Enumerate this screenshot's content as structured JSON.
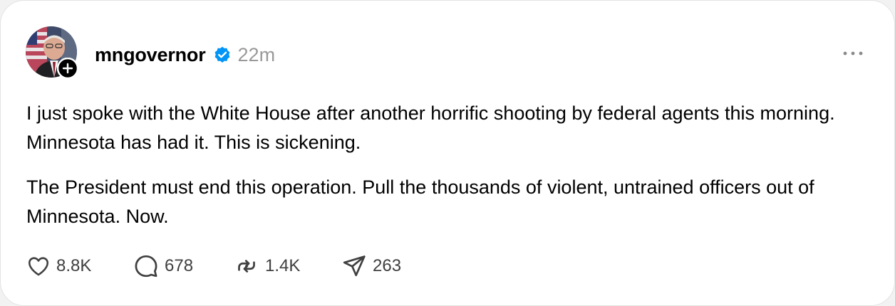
{
  "post": {
    "username": "mngovernor",
    "verified": true,
    "timestamp": "22m",
    "more_icon": "more-horizontal-icon",
    "paragraphs": [
      "I just spoke with the White House after another horrific shooting by federal agents this morning. Minnesota has had it. This is sickening.",
      "The President must end this operation. Pull the thousands of violent, untrained officers out of Minnesota. Now."
    ]
  },
  "actions": {
    "like": {
      "icon": "heart-icon",
      "count": "8.8K"
    },
    "reply": {
      "icon": "comment-icon",
      "count": "678"
    },
    "repost": {
      "icon": "repost-icon",
      "count": "1.4K"
    },
    "share": {
      "icon": "send-icon",
      "count": "263"
    }
  },
  "colors": {
    "verified": "#0095f6",
    "text": "#000000",
    "secondary_text": "#999999",
    "icon": "#404040"
  }
}
